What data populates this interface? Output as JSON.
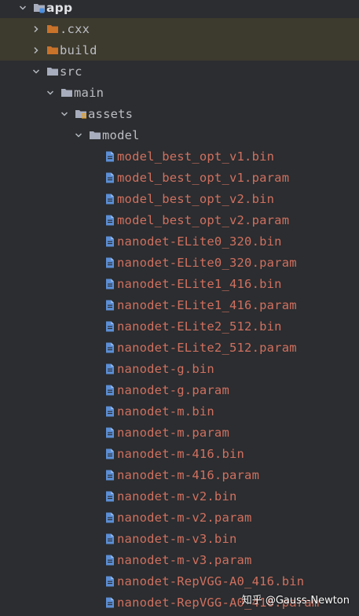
{
  "tree": {
    "app": "app",
    "cxx": ".cxx",
    "build": "build",
    "src": "src",
    "main": "main",
    "assets": "assets",
    "model": "model",
    "files": [
      "model_best_opt_v1.bin",
      "model_best_opt_v1.param",
      "model_best_opt_v2.bin",
      "model_best_opt_v2.param",
      "nanodet-ELite0_320.bin",
      "nanodet-ELite0_320.param",
      "nanodet-ELite1_416.bin",
      "nanodet-ELite1_416.param",
      "nanodet-ELite2_512.bin",
      "nanodet-ELite2_512.param",
      "nanodet-g.bin",
      "nanodet-g.param",
      "nanodet-m.bin",
      "nanodet-m.param",
      "nanodet-m-416.bin",
      "nanodet-m-416.param",
      "nanodet-m-v2.bin",
      "nanodet-m-v2.param",
      "nanodet-m-v3.bin",
      "nanodet-m-v3.param",
      "nanodet-RepVGG-A0_416.bin",
      "nanodet-RepVGG-A0_416.param"
    ]
  },
  "watermark": "知乎 @Gauss-Newton",
  "icons": {
    "module": "module-folder-icon",
    "folder": "folder-icon",
    "excluded_folder": "excluded-folder-icon",
    "resources_folder": "resources-folder-icon",
    "file": "file-icon"
  },
  "colors": {
    "background": "#2b2d30",
    "excluded_row": "#3d3a2e",
    "text": "#bcbec4",
    "untracked_text": "#d0705f",
    "folder": "#a8adbd",
    "excluded_folder": "#c9722a",
    "file_icon": "#5c8fd6"
  }
}
